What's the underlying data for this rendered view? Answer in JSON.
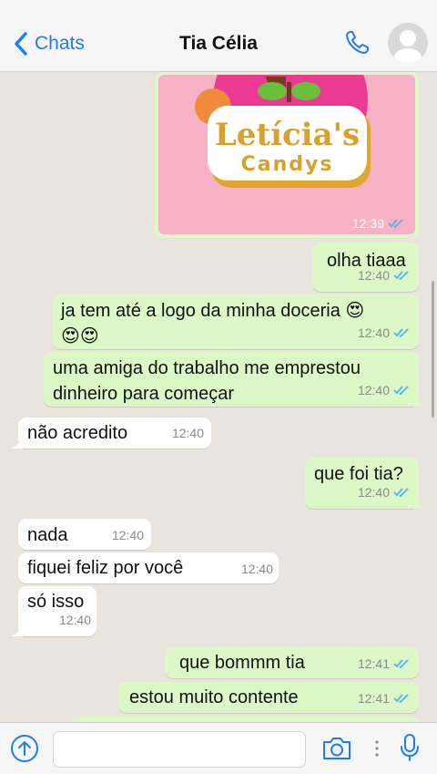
{
  "header": {
    "back_label": "Chats",
    "title": "Tia Célia"
  },
  "image_message": {
    "logo_line1": "Letícia's",
    "logo_line2": "Candys",
    "time": "12:39"
  },
  "messages": [
    {
      "dir": "out",
      "text": "olha tiaaa",
      "time": "12:40"
    },
    {
      "dir": "out",
      "text": "ja tem até a logo da minha doceria 😍\n😍😍",
      "time": "12:40"
    },
    {
      "dir": "out",
      "text": "uma amiga do trabalho me emprestou\ndinheiro para começar",
      "time": "12:40"
    },
    {
      "dir": "in",
      "text": "não acredito",
      "time": "12:40"
    },
    {
      "dir": "out",
      "text": "que foi tia?",
      "time": "12:40"
    },
    {
      "dir": "in",
      "text": "nada",
      "time": "12:40"
    },
    {
      "dir": "in",
      "text": "fiquei feliz por você",
      "time": "12:40"
    },
    {
      "dir": "in",
      "text": "só isso",
      "time": "12:40"
    },
    {
      "dir": "out",
      "text": "que bommm tia",
      "time": "12:41"
    },
    {
      "dir": "out",
      "text": "estou muito contente",
      "time": "12:41"
    }
  ],
  "footer": {
    "input_placeholder": ""
  },
  "colors": {
    "accent": "#1f7cf6",
    "outgoing": "#dcf8c6",
    "incoming": "#ffffff",
    "chat_bg": "#e9e4dd",
    "ticks": "#4fb3f6"
  },
  "icons": [
    "chevron-left-icon",
    "phone-icon",
    "avatar-icon",
    "double-check-icon",
    "upload-icon",
    "camera-icon",
    "more-icon",
    "microphone-icon"
  ]
}
